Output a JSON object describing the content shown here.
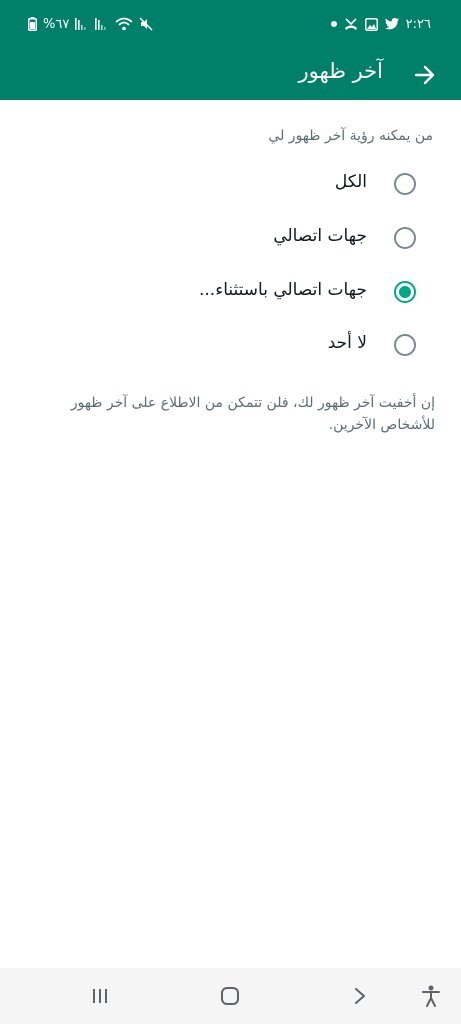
{
  "status_bar": {
    "time": "٢:٢٦",
    "battery_percent": "%٦٧",
    "left_icons": [
      "battery-icon",
      "signal-icon",
      "signal-icon",
      "wifi-icon",
      "mute-icon"
    ],
    "right_icons": [
      "notification-dot-icon",
      "missed-call-icon",
      "gallery-icon",
      "twitter-icon"
    ]
  },
  "app_bar": {
    "title": "آخر ظهور",
    "back_icon": "arrow-right-icon"
  },
  "settings": {
    "section_label": "من يمكنه رؤية آخر ظهور لي",
    "options": [
      {
        "label": "الكل",
        "checked": false
      },
      {
        "label": "جهات اتصالي",
        "checked": false
      },
      {
        "label": "جهات اتصالي باستثناء...",
        "checked": true
      },
      {
        "label": "لا أحد",
        "checked": false
      }
    ],
    "footnote": "إن أخفيت آخر ظهور لك، فلن تتمكن من الاطلاع على آخر ظهور للأشخاص الآخرين."
  },
  "nav_bar": {
    "icons": [
      "recents-icon",
      "home-icon",
      "back-chevron-icon",
      "accessibility-icon"
    ]
  },
  "colors": {
    "primary": "#008069",
    "accent": "#00a884",
    "text_primary": "#111b21",
    "text_secondary": "#5b6b74"
  }
}
